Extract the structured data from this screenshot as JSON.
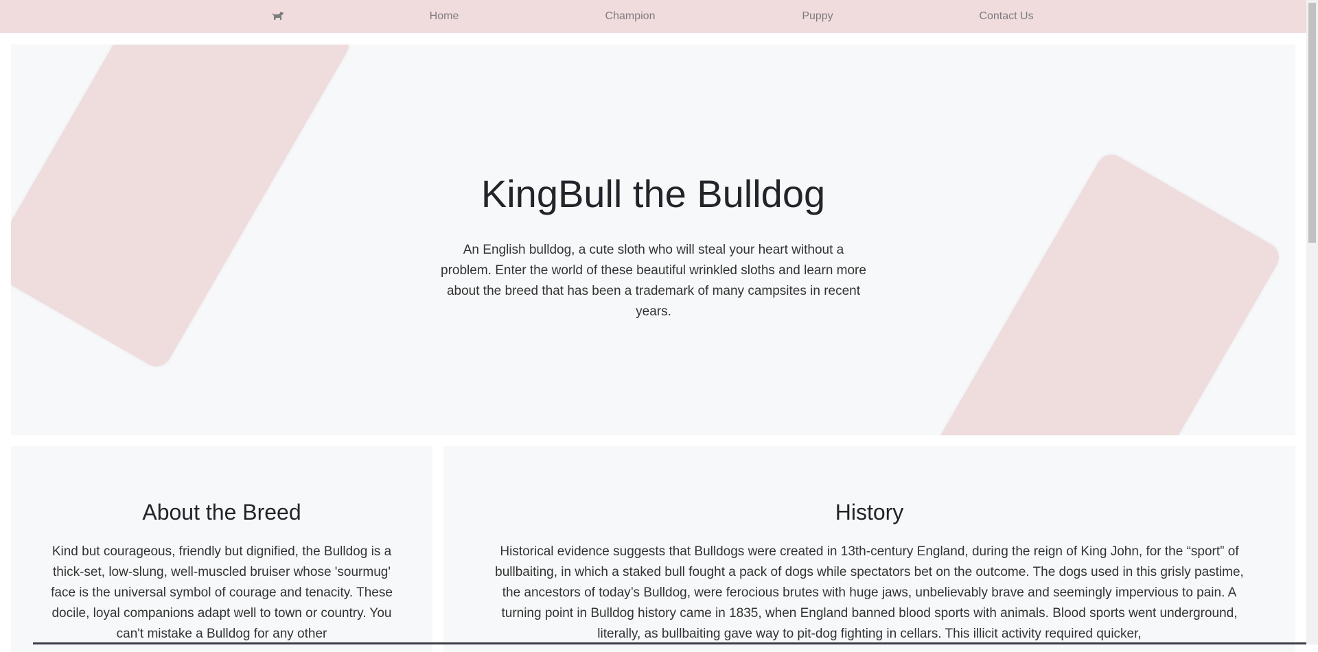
{
  "nav": {
    "logo_icon": "dog-icon",
    "home": "Home",
    "champion": "Champion",
    "puppy": "Puppy",
    "contact": "Contact Us",
    "background": "#f0dbdd"
  },
  "hero": {
    "title": "KingBull the Bulldog",
    "description": "An English bulldog, a cute sloth who will steal your heart without a problem. Enter the world of these beautiful wrinkled sloths and learn more about the breed that has been a trademark of many campsites in recent years.",
    "background": "#f7f8fa",
    "accent": "#efdcdd"
  },
  "about": {
    "title": "About the Breed",
    "text": "Kind but courageous, friendly but dignified, the Bulldog is a thick-set, low-slung, well-muscled bruiser whose 'sourmug' face is the universal symbol of courage and tenacity. These docile, loyal companions adapt well to town or country. You can't mistake a Bulldog for any other"
  },
  "history": {
    "title": "History",
    "text": "Historical evidence suggests that Bulldogs were created in 13th-century England, during the reign of King John, for the “sport” of bullbaiting, in which a staked bull fought a pack of dogs while spectators bet on the outcome. The dogs used in this grisly pastime, the ancestors of today’s Bulldog, were ferocious brutes with huge jaws, unbelievably brave and seemingly impervious to pain. A turning point in Bulldog history came in 1835, when England banned blood sports with animals. Blood sports went underground, literally, as bullbaiting gave way to pit-dog fighting in cellars. This illicit activity required quicker,"
  }
}
